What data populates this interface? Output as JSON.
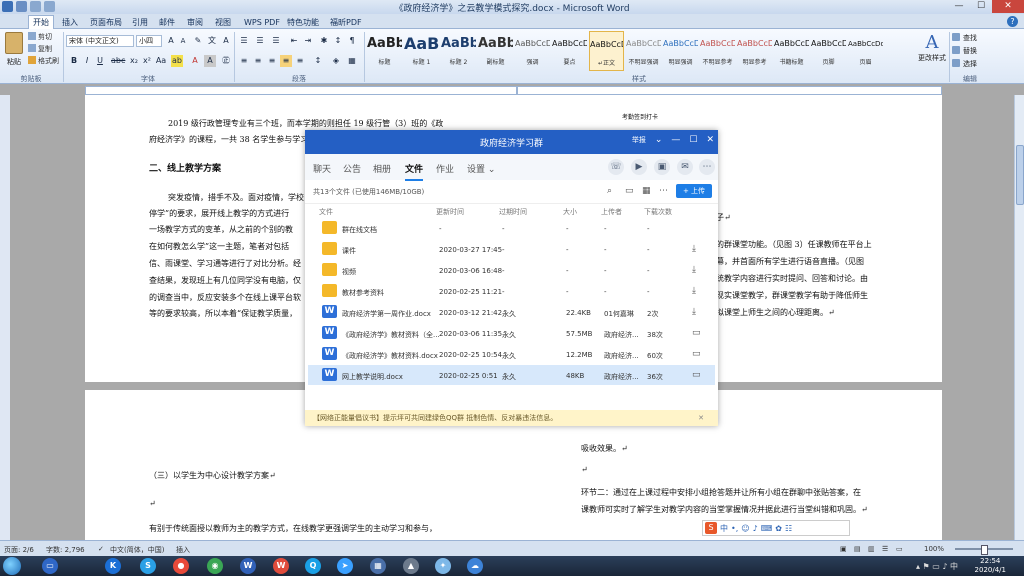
{
  "window": {
    "title": "《政府经济学》之云教学模式探究.docx - Microsoft Word"
  },
  "ribbon": {
    "tabs": [
      "开始",
      "插入",
      "页面布局",
      "引用",
      "邮件",
      "审阅",
      "视图",
      "WPS PDF",
      "特色功能",
      "福昕PDF"
    ],
    "clipboard": {
      "paste": "粘贴",
      "cut": "剪切",
      "copy": "复制",
      "format_painter": "格式刷",
      "label": "剪贴板"
    },
    "font": {
      "name": "宋体 (中文正文)",
      "size": "小四",
      "label": "字体"
    },
    "paragraph_label": "段落",
    "styles": [
      {
        "sample": "AaBbC",
        "name": "标题"
      },
      {
        "sample": "AaBb",
        "name": "标题 1"
      },
      {
        "sample": "AaBbC",
        "name": "标题 2"
      },
      {
        "sample": "AaBb",
        "name": "副标题"
      },
      {
        "sample": "AaBbCcDd",
        "name": "强调"
      },
      {
        "sample": "AaBbCcDd",
        "name": "要点"
      },
      {
        "sample": "AaBbCcDd",
        "name": "↵正文"
      },
      {
        "sample": "AaBbCcDd",
        "name": "不明显强调"
      },
      {
        "sample": "AaBbCcDd",
        "name": "明显强调"
      },
      {
        "sample": "AaBbCcDd",
        "name": "不明显参考"
      },
      {
        "sample": "AaBbCcDd",
        "name": "明显参考"
      },
      {
        "sample": "AaBbCcDd",
        "name": "书籍标题"
      },
      {
        "sample": "AaBbCcDd",
        "name": "页脚"
      },
      {
        "sample": "AaBbCcDdE",
        "name": "页眉"
      }
    ],
    "styles_label": "样式",
    "change_styles": "更改样式",
    "editing": {
      "find": "查找",
      "replace": "替换",
      "select": "选择",
      "label": "编辑"
    }
  },
  "document": {
    "left_page_top": [
      "2019 级行政管理专业有三个班，而本学期的则担任 19 级行管（3）班的《政",
      "府经济学》的课程，一共 38 名学生参与学习。"
    ],
    "heading_2": "二、线上教学方案",
    "left_page_body": [
      "突发疫情，措手不及。面对疫情，学校",
      "停学”的要求，展开线上教学的方式进行",
      "一场教学方式的变革，从之前的个别的教",
      "在如何教怎么学”这一主题，笔者对包括",
      "信、雨课堂、学习通等进行了对比分析。经",
      "查结果，发现班上有几位同学没有电脑，仅",
      "的调查当中，反应安装多个在线上课平台软",
      "等的要求较高，所以本着“保证教学质量，"
    ],
    "right_page_top": [
      "考勤签到打卡"
    ],
    "right_page_body": [
      "子↵",
      "的群课堂功能。（见图 3）任课教师在平台上",
      "幕，并首面所有学生进行语音直播。（见图",
      "统教学内容进行实时提问、回答和讨论。由",
      "现实课堂教学，群课堂教学有助于降低师生",
      "拟课堂上师生之间的心理距离。↵"
    ],
    "lower_left": [
      "（三）以学生为中心设计教学方案↵",
      "↵",
      "有别于传统面授以教师为主的教学方式，在线教学更强调学生的主动学习和参与，"
    ],
    "lower_right": [
      "吸收效果。↵",
      "↵",
      "环节二：通过在上课过程中安排小组抢答题并让所有小组在群聊中张贴答案，在",
      "课教师可实时了解学生对教学内容的当堂掌握情况并据此进行当堂纠错和巩固。↵"
    ]
  },
  "qq": {
    "title": "政府经济学习群",
    "title_controls": [
      "举报",
      "⌄",
      "—",
      "☐",
      "✕"
    ],
    "nav": [
      "聊天",
      "公告",
      "相册",
      "文件",
      "作业",
      "设置 ⌄"
    ],
    "active_nav": "文件",
    "summary": "共13个文件 (已使用146MB/10GB)",
    "upload": "+ 上传",
    "columns": [
      "文件",
      "更新时间",
      "过期时间",
      "大小",
      "上传者",
      "下载次数"
    ],
    "files": [
      {
        "type": "folder",
        "name": "群在线文档",
        "time": "-",
        "expire": "-",
        "size": "-",
        "uploader": "-",
        "downloads": "-",
        "action": ""
      },
      {
        "type": "folder",
        "name": "课件",
        "time": "2020-03-27 17:45",
        "expire": "-",
        "size": "-",
        "uploader": "-",
        "downloads": "-",
        "action": "⤓"
      },
      {
        "type": "folder",
        "name": "视频",
        "time": "2020-03-06 16:48",
        "expire": "-",
        "size": "-",
        "uploader": "-",
        "downloads": "-",
        "action": "⤓"
      },
      {
        "type": "folder",
        "name": "教材参考资料",
        "time": "2020-02-25 11:21",
        "expire": "-",
        "size": "-",
        "uploader": "-",
        "downloads": "-",
        "action": "⤓"
      },
      {
        "type": "word",
        "name": "政府经济学第一周作业.docx",
        "time": "2020-03-12 21:42",
        "expire": "永久",
        "size": "22.4KB",
        "uploader": "01何嘉琳",
        "downloads": "2次",
        "action": "⤓"
      },
      {
        "type": "word",
        "name": "《政府经济学》教材资料（全...",
        "time": "2020-03-06 11:35",
        "expire": "永久",
        "size": "57.5MB",
        "uploader": "政府经济...",
        "downloads": "38次",
        "action": "▭"
      },
      {
        "type": "word",
        "name": "《政府经济学》教材资料.docx",
        "time": "2020-02-25 10:54",
        "expire": "永久",
        "size": "12.2MB",
        "uploader": "政府经济...",
        "downloads": "60次",
        "action": "▭"
      },
      {
        "type": "word",
        "name": "网上教学说明.docx",
        "time": "2020-02-25 0:51",
        "expire": "永久",
        "size": "48KB",
        "uploader": "政府经济...",
        "downloads": "36次",
        "action": "▭"
      }
    ],
    "notice": "【网络正能量倡议书】提示坪可共同建绿色QQ群 抵制色情、反对暴违法信息。",
    "notice_close": "✕"
  },
  "statusbar": {
    "page": "页面: 2/6",
    "words": "字数: 2,796",
    "lang": "中文(简体，中国)",
    "mode": "插入",
    "zoom": "100%"
  },
  "ime": {
    "logo": "S",
    "lang": "中"
  },
  "taskbar": {
    "time": "22:54",
    "date": "2020/4/1"
  },
  "colors": {
    "qq_blue": "#245fc4",
    "upload_blue": "#1e7ee6",
    "folder": "#f4b829",
    "word": "#2d6fd8"
  }
}
